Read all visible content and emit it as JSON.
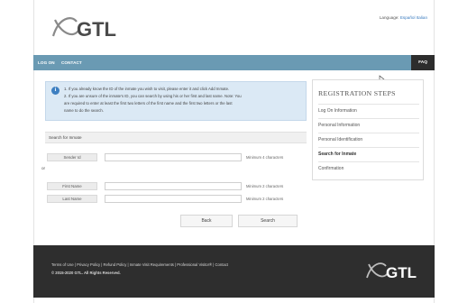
{
  "header": {
    "brand": "GTL",
    "language_label": "Language:",
    "language_link": "Español Italian"
  },
  "nav": {
    "items": [
      {
        "label": "LOG ON"
      },
      {
        "label": "CONTACT"
      }
    ],
    "faq": "FAQ"
  },
  "info": {
    "line1": "1. If you already know the ID of the inmate you wish to visit, please enter it and click Add Inmate.",
    "line2": "2. If you are unsure of the inmate's ID, you can search by using his or her first and last name. Note: You",
    "line3": "are required to enter at least the first two letters of the first name and the first two letters or the last",
    "line4": "name to do the search."
  },
  "search": {
    "heading": "Search for Inmate",
    "or_label": "or",
    "fields": [
      {
        "label": "Sender Id",
        "value": "",
        "hint": "Minimum 4 characters"
      },
      {
        "label": "First Name",
        "value": "",
        "hint": "Minimum 2 characters"
      },
      {
        "label": "Last Name",
        "value": "",
        "hint": "Minimum 2 characters"
      }
    ],
    "back_button": "Back",
    "search_button": "Search"
  },
  "steps": {
    "title": "REGISTRATION STEPS",
    "items": [
      {
        "label": "Log On Information"
      },
      {
        "label": "Personal Information"
      },
      {
        "label": "Personal Identification"
      },
      {
        "label": "Search for Inmate"
      },
      {
        "label": "Confirmation"
      }
    ],
    "active_index": 3
  },
  "footer": {
    "links": "Terms of Use | Privacy Policy | Refund Policy | Inmate Visit Requirements | Professional Visitor® | Contact",
    "copyright": "© 2015-2020 GTL. All Rights Reserved.",
    "brand": "GTL"
  },
  "colors": {
    "nav_bg": "#6a9ab3",
    "faq_bg": "#2d2d2d",
    "info_bg": "#dbe9f5",
    "footer_bg": "#2e2e2e",
    "link": "#3a7bbf"
  }
}
